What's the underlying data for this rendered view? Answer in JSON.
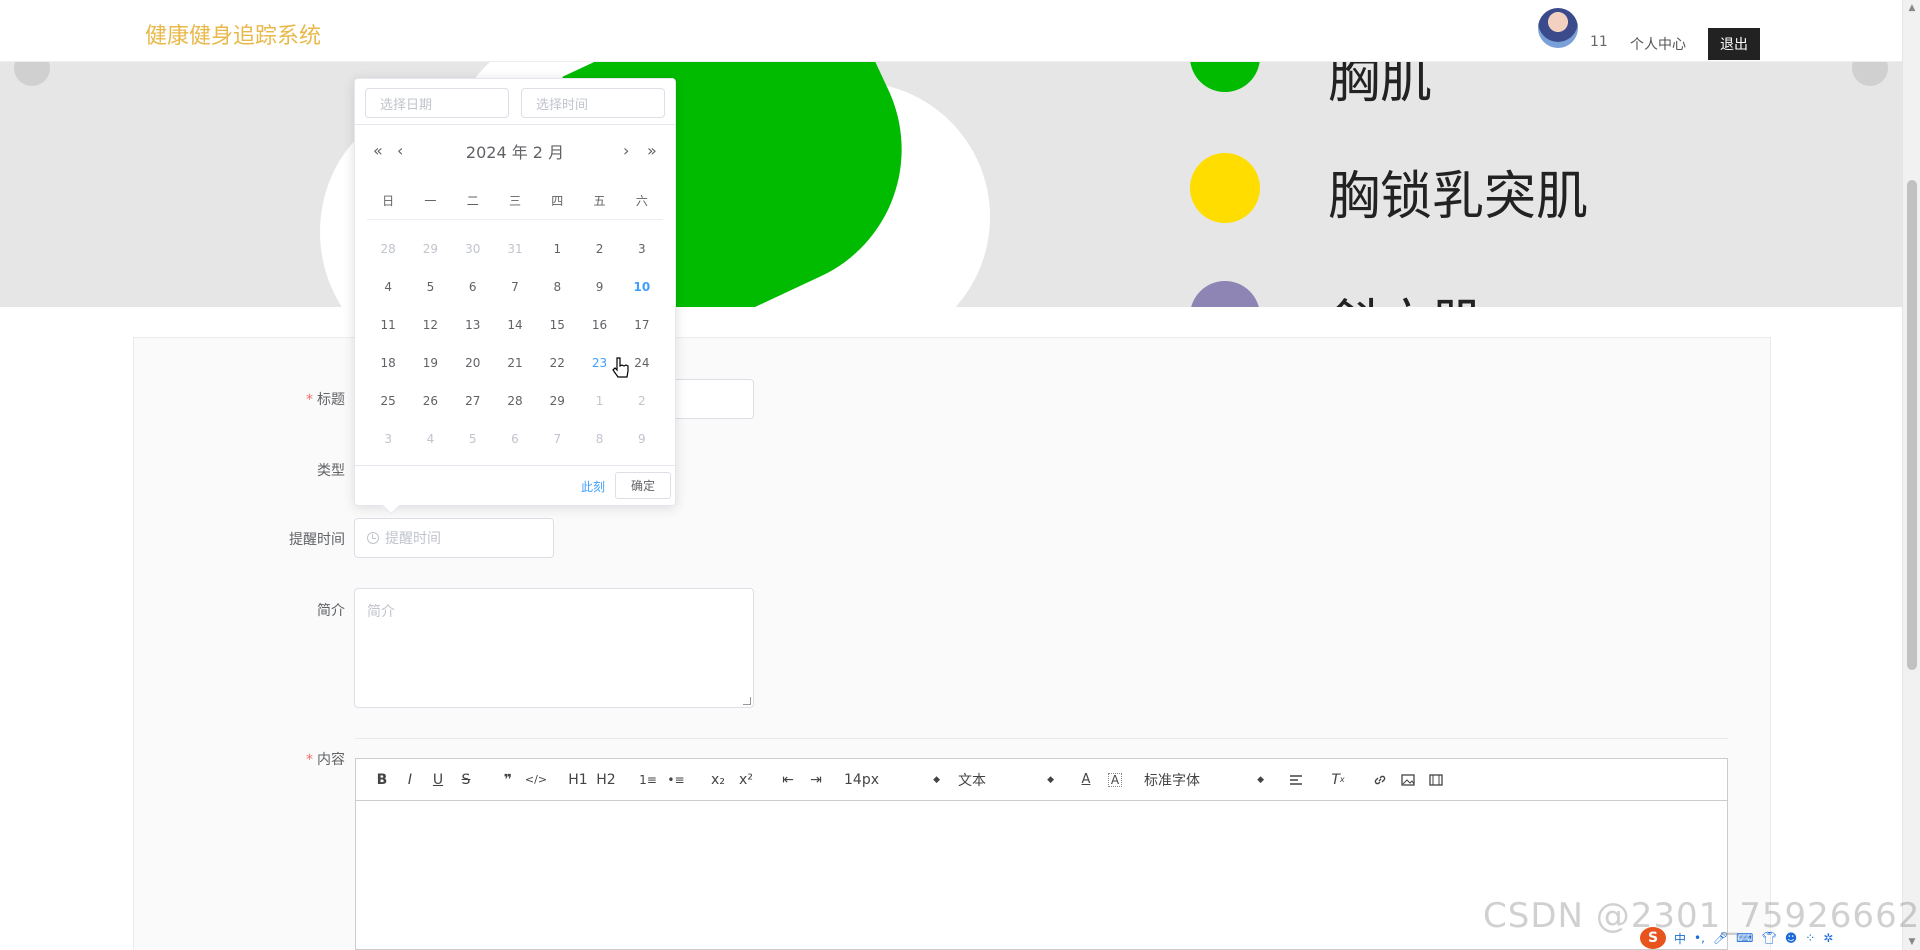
{
  "header": {
    "app_title": "健康健身追踪系统",
    "user_id": "11",
    "profile_link": "个人中心",
    "logout_label": "退出"
  },
  "banner": {
    "legend": [
      {
        "label": "胸肌",
        "color": "#00bb00"
      },
      {
        "label": "胸锁乳突肌",
        "color": "#ffdd00"
      },
      {
        "label": "斜方肌",
        "color": "#8f85b5"
      }
    ]
  },
  "form": {
    "title_label": "标题",
    "type_label": "类型",
    "remind_time_label": "提醒时间",
    "remind_time_placeholder": "提醒时间",
    "intro_label": "简介",
    "intro_placeholder": "简介",
    "content_label": "内容"
  },
  "editor_toolbar": {
    "font_size": "14px",
    "block_type": "文本",
    "font_family": "标准字体",
    "buttons": [
      "B",
      "I",
      "U",
      "S",
      "❞",
      "</>",
      "H1",
      "H2",
      "1≡",
      "•≡",
      "x₂",
      "x²",
      "⇤",
      "⇥"
    ]
  },
  "date_picker": {
    "date_placeholder": "选择日期",
    "time_placeholder": "选择时间",
    "year_month": "2024 年  2 月",
    "weekdays": [
      "日",
      "一",
      "二",
      "三",
      "四",
      "五",
      "六"
    ],
    "days": [
      {
        "d": "28",
        "t": "other"
      },
      {
        "d": "29",
        "t": "other"
      },
      {
        "d": "30",
        "t": "other"
      },
      {
        "d": "31",
        "t": "other"
      },
      {
        "d": "1",
        "t": ""
      },
      {
        "d": "2",
        "t": ""
      },
      {
        "d": "3",
        "t": ""
      },
      {
        "d": "4",
        "t": ""
      },
      {
        "d": "5",
        "t": ""
      },
      {
        "d": "6",
        "t": ""
      },
      {
        "d": "7",
        "t": ""
      },
      {
        "d": "8",
        "t": ""
      },
      {
        "d": "9",
        "t": ""
      },
      {
        "d": "10",
        "t": "today"
      },
      {
        "d": "11",
        "t": ""
      },
      {
        "d": "12",
        "t": ""
      },
      {
        "d": "13",
        "t": ""
      },
      {
        "d": "14",
        "t": ""
      },
      {
        "d": "15",
        "t": ""
      },
      {
        "d": "16",
        "t": ""
      },
      {
        "d": "17",
        "t": ""
      },
      {
        "d": "18",
        "t": ""
      },
      {
        "d": "19",
        "t": ""
      },
      {
        "d": "20",
        "t": ""
      },
      {
        "d": "21",
        "t": ""
      },
      {
        "d": "22",
        "t": ""
      },
      {
        "d": "23",
        "t": "selected"
      },
      {
        "d": "24",
        "t": ""
      },
      {
        "d": "25",
        "t": ""
      },
      {
        "d": "26",
        "t": ""
      },
      {
        "d": "27",
        "t": ""
      },
      {
        "d": "28",
        "t": ""
      },
      {
        "d": "29",
        "t": ""
      },
      {
        "d": "1",
        "t": "other"
      },
      {
        "d": "2",
        "t": "other"
      },
      {
        "d": "3",
        "t": "other"
      },
      {
        "d": "4",
        "t": "other"
      },
      {
        "d": "5",
        "t": "other"
      },
      {
        "d": "6",
        "t": "other"
      },
      {
        "d": "7",
        "t": "other"
      },
      {
        "d": "8",
        "t": "other"
      },
      {
        "d": "9",
        "t": "other"
      }
    ],
    "now_label": "此刻",
    "confirm_label": "确定"
  },
  "watermark": "CSDN @2301_75926662",
  "tray": {
    "ime": "中"
  }
}
